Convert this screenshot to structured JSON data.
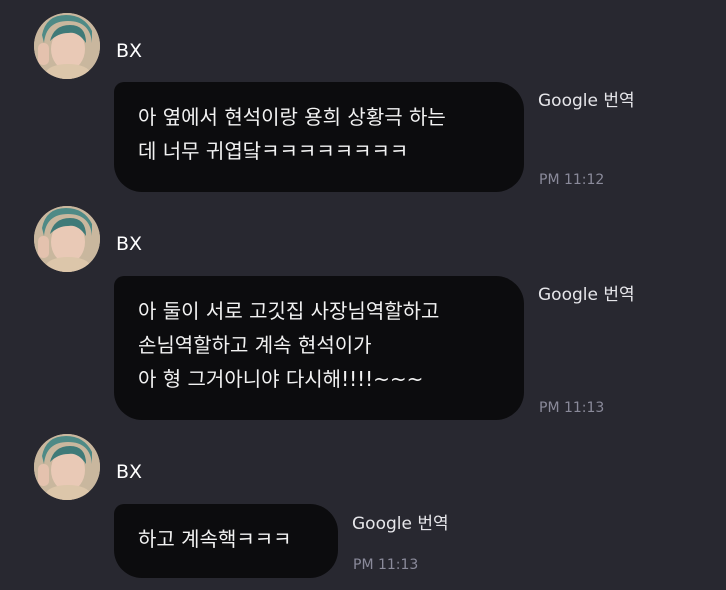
{
  "messages": [
    {
      "sender": "BX",
      "text": "아 옆에서 현석이랑 용희 상황극 하는\n데 너무 귀엽닼ㅋㅋㅋㅋㅋㅋㅋㅋ",
      "translate_label": "Google 번역",
      "time": "PM 11:12"
    },
    {
      "sender": "BX",
      "text": "아 둘이 서로 고깃집 사장님역할하고\n손님역할하고 계속 현석이가\n아 형 그거아니야 다시해!!!!~~~",
      "translate_label": "Google 번역",
      "time": "PM 11:13"
    },
    {
      "sender": "BX",
      "text": "하고 계속핵ㅋㅋㅋ",
      "translate_label": "Google 번역",
      "time": "PM 11:13"
    }
  ]
}
